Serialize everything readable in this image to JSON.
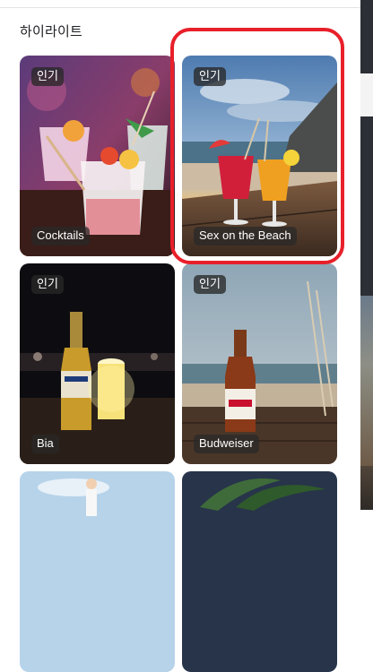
{
  "section": {
    "title": "하이라이트"
  },
  "cards": [
    {
      "badge": "인기",
      "label": "Cocktails",
      "image": "cocktails-photo"
    },
    {
      "badge": "인기",
      "label": "Sex on the Beach",
      "image": "beach-cocktail-photo"
    },
    {
      "badge": "인기",
      "label": "Bia",
      "image": "corona-beer-photo"
    },
    {
      "badge": "인기",
      "label": "Budweiser",
      "image": "budweiser-beer-photo"
    },
    {
      "badge": "",
      "label": "",
      "image": "beach-person-photo"
    },
    {
      "badge": "",
      "label": "",
      "image": "palm-tree-photo"
    }
  ],
  "colors": {
    "highlight_ring": "#e8202a",
    "badge_bg": "#282828"
  }
}
